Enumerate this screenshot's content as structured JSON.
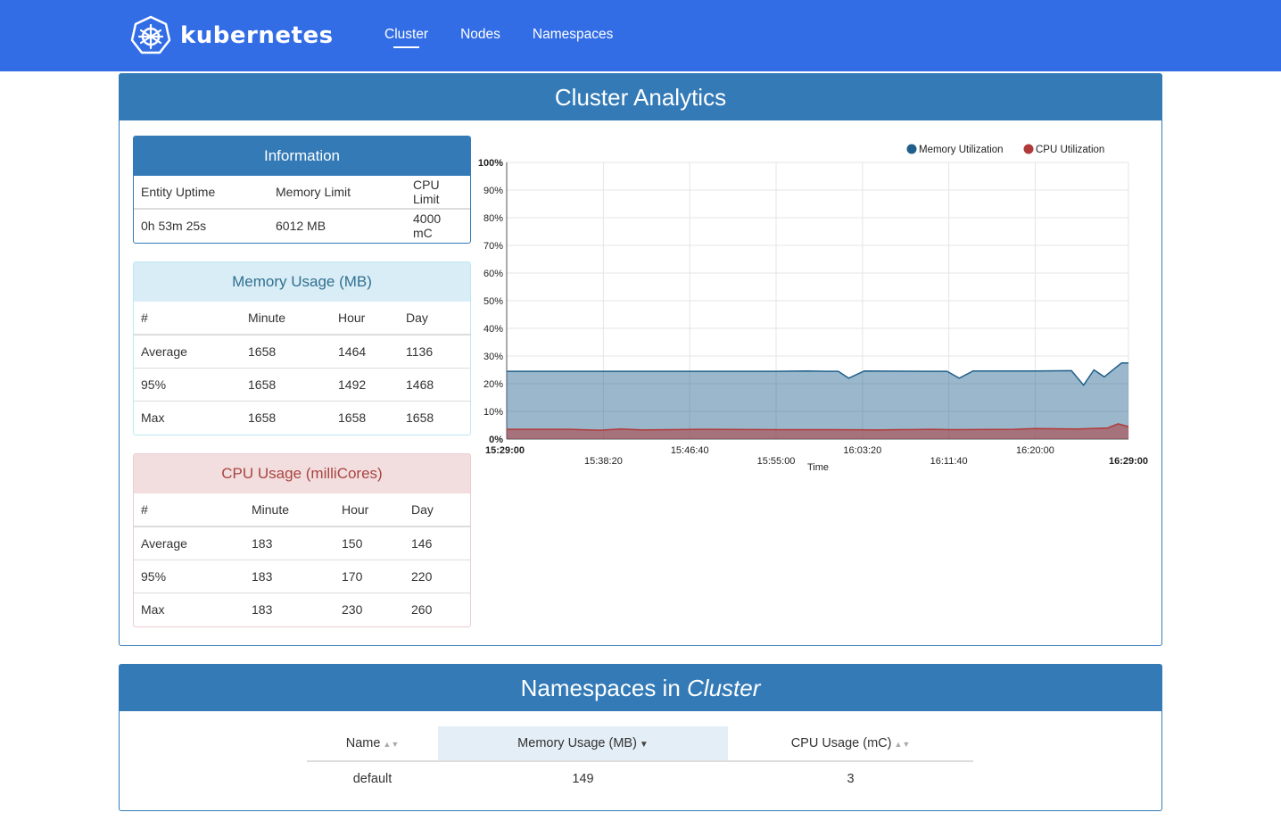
{
  "brand": {
    "name": "kubernetes",
    "icon": "kubernetes-helm-icon"
  },
  "nav": [
    {
      "label": "Cluster",
      "active": true
    },
    {
      "label": "Nodes",
      "active": false
    },
    {
      "label": "Namespaces",
      "active": false
    }
  ],
  "analytics": {
    "title": "Cluster Analytics",
    "information": {
      "title": "Information",
      "headers": [
        "Entity Uptime",
        "Memory Limit",
        "CPU Limit"
      ],
      "values": [
        "0h 53m 25s",
        "6012 MB",
        "4000 mC"
      ]
    },
    "memory": {
      "title": "Memory Usage (MB)",
      "headers": [
        "#",
        "Minute",
        "Hour",
        "Day"
      ],
      "rows": [
        [
          "Average",
          "1658",
          "1464",
          "1136"
        ],
        [
          "95%",
          "1658",
          "1492",
          "1468"
        ],
        [
          "Max",
          "1658",
          "1658",
          "1658"
        ]
      ]
    },
    "cpu": {
      "title": "CPU Usage (milliCores)",
      "headers": [
        "#",
        "Minute",
        "Hour",
        "Day"
      ],
      "rows": [
        [
          "Average",
          "183",
          "150",
          "146"
        ],
        [
          "95%",
          "183",
          "170",
          "220"
        ],
        [
          "Max",
          "183",
          "230",
          "260"
        ]
      ]
    }
  },
  "chart_data": {
    "type": "area",
    "xlabel": "Time",
    "ylabel": "",
    "ylim": [
      0,
      100
    ],
    "y_ticks": [
      "0%",
      "10%",
      "20%",
      "30%",
      "40%",
      "50%",
      "60%",
      "70%",
      "80%",
      "90%",
      "100%"
    ],
    "x_range": [
      "15:29:00",
      "16:29:00"
    ],
    "x_ticks": [
      "15:29:00",
      "15:38:20",
      "15:46:40",
      "15:55:00",
      "16:03:20",
      "16:11:40",
      "16:20:00",
      "16:29:00"
    ],
    "legend": "top-right",
    "grid": true,
    "series": [
      {
        "name": "Memory Utilization",
        "color": "#1f5f8b",
        "x": [
          "15:29:00",
          "15:35:00",
          "15:45:00",
          "15:55:00",
          "15:58:00",
          "16:00:00",
          "16:01:00",
          "16:02:00",
          "16:03:30",
          "16:10:00",
          "16:11:30",
          "16:12:40",
          "16:14:00",
          "16:20:00",
          "16:23:30",
          "16:24:40",
          "16:25:40",
          "16:26:40",
          "16:27:40",
          "16:28:20",
          "16:29:00"
        ],
        "values": [
          24.5,
          24.5,
          24.5,
          24.5,
          24.6,
          24.5,
          24.5,
          22,
          24.6,
          24.5,
          24.5,
          22,
          24.6,
          24.6,
          24.7,
          19.5,
          25,
          22.5,
          25.5,
          27.5,
          27.5
        ]
      },
      {
        "name": "CPU Utilization",
        "color": "#b03a3a",
        "x": [
          "15:29:00",
          "15:35:00",
          "15:38:00",
          "15:40:00",
          "15:42:00",
          "15:48:00",
          "15:55:00",
          "16:00:00",
          "16:05:00",
          "16:10:00",
          "16:12:00",
          "16:18:00",
          "16:20:00",
          "16:24:00",
          "16:27:00",
          "16:28:00",
          "16:29:00"
        ],
        "values": [
          3.5,
          3.5,
          3.2,
          3.6,
          3.3,
          3.5,
          3.4,
          3.4,
          3.3,
          3.5,
          3.4,
          3.5,
          3.8,
          3.6,
          4.0,
          5.5,
          4.5
        ]
      }
    ]
  },
  "namespaces": {
    "title_prefix": "Namespaces in",
    "title_emph": "Cluster",
    "columns": [
      "Name",
      "Memory Usage (MB)",
      "CPU Usage (mC)"
    ],
    "sorted_column": "Memory Usage (MB)",
    "rows": [
      {
        "name": "default",
        "memory": "149",
        "cpu": "3"
      }
    ]
  }
}
